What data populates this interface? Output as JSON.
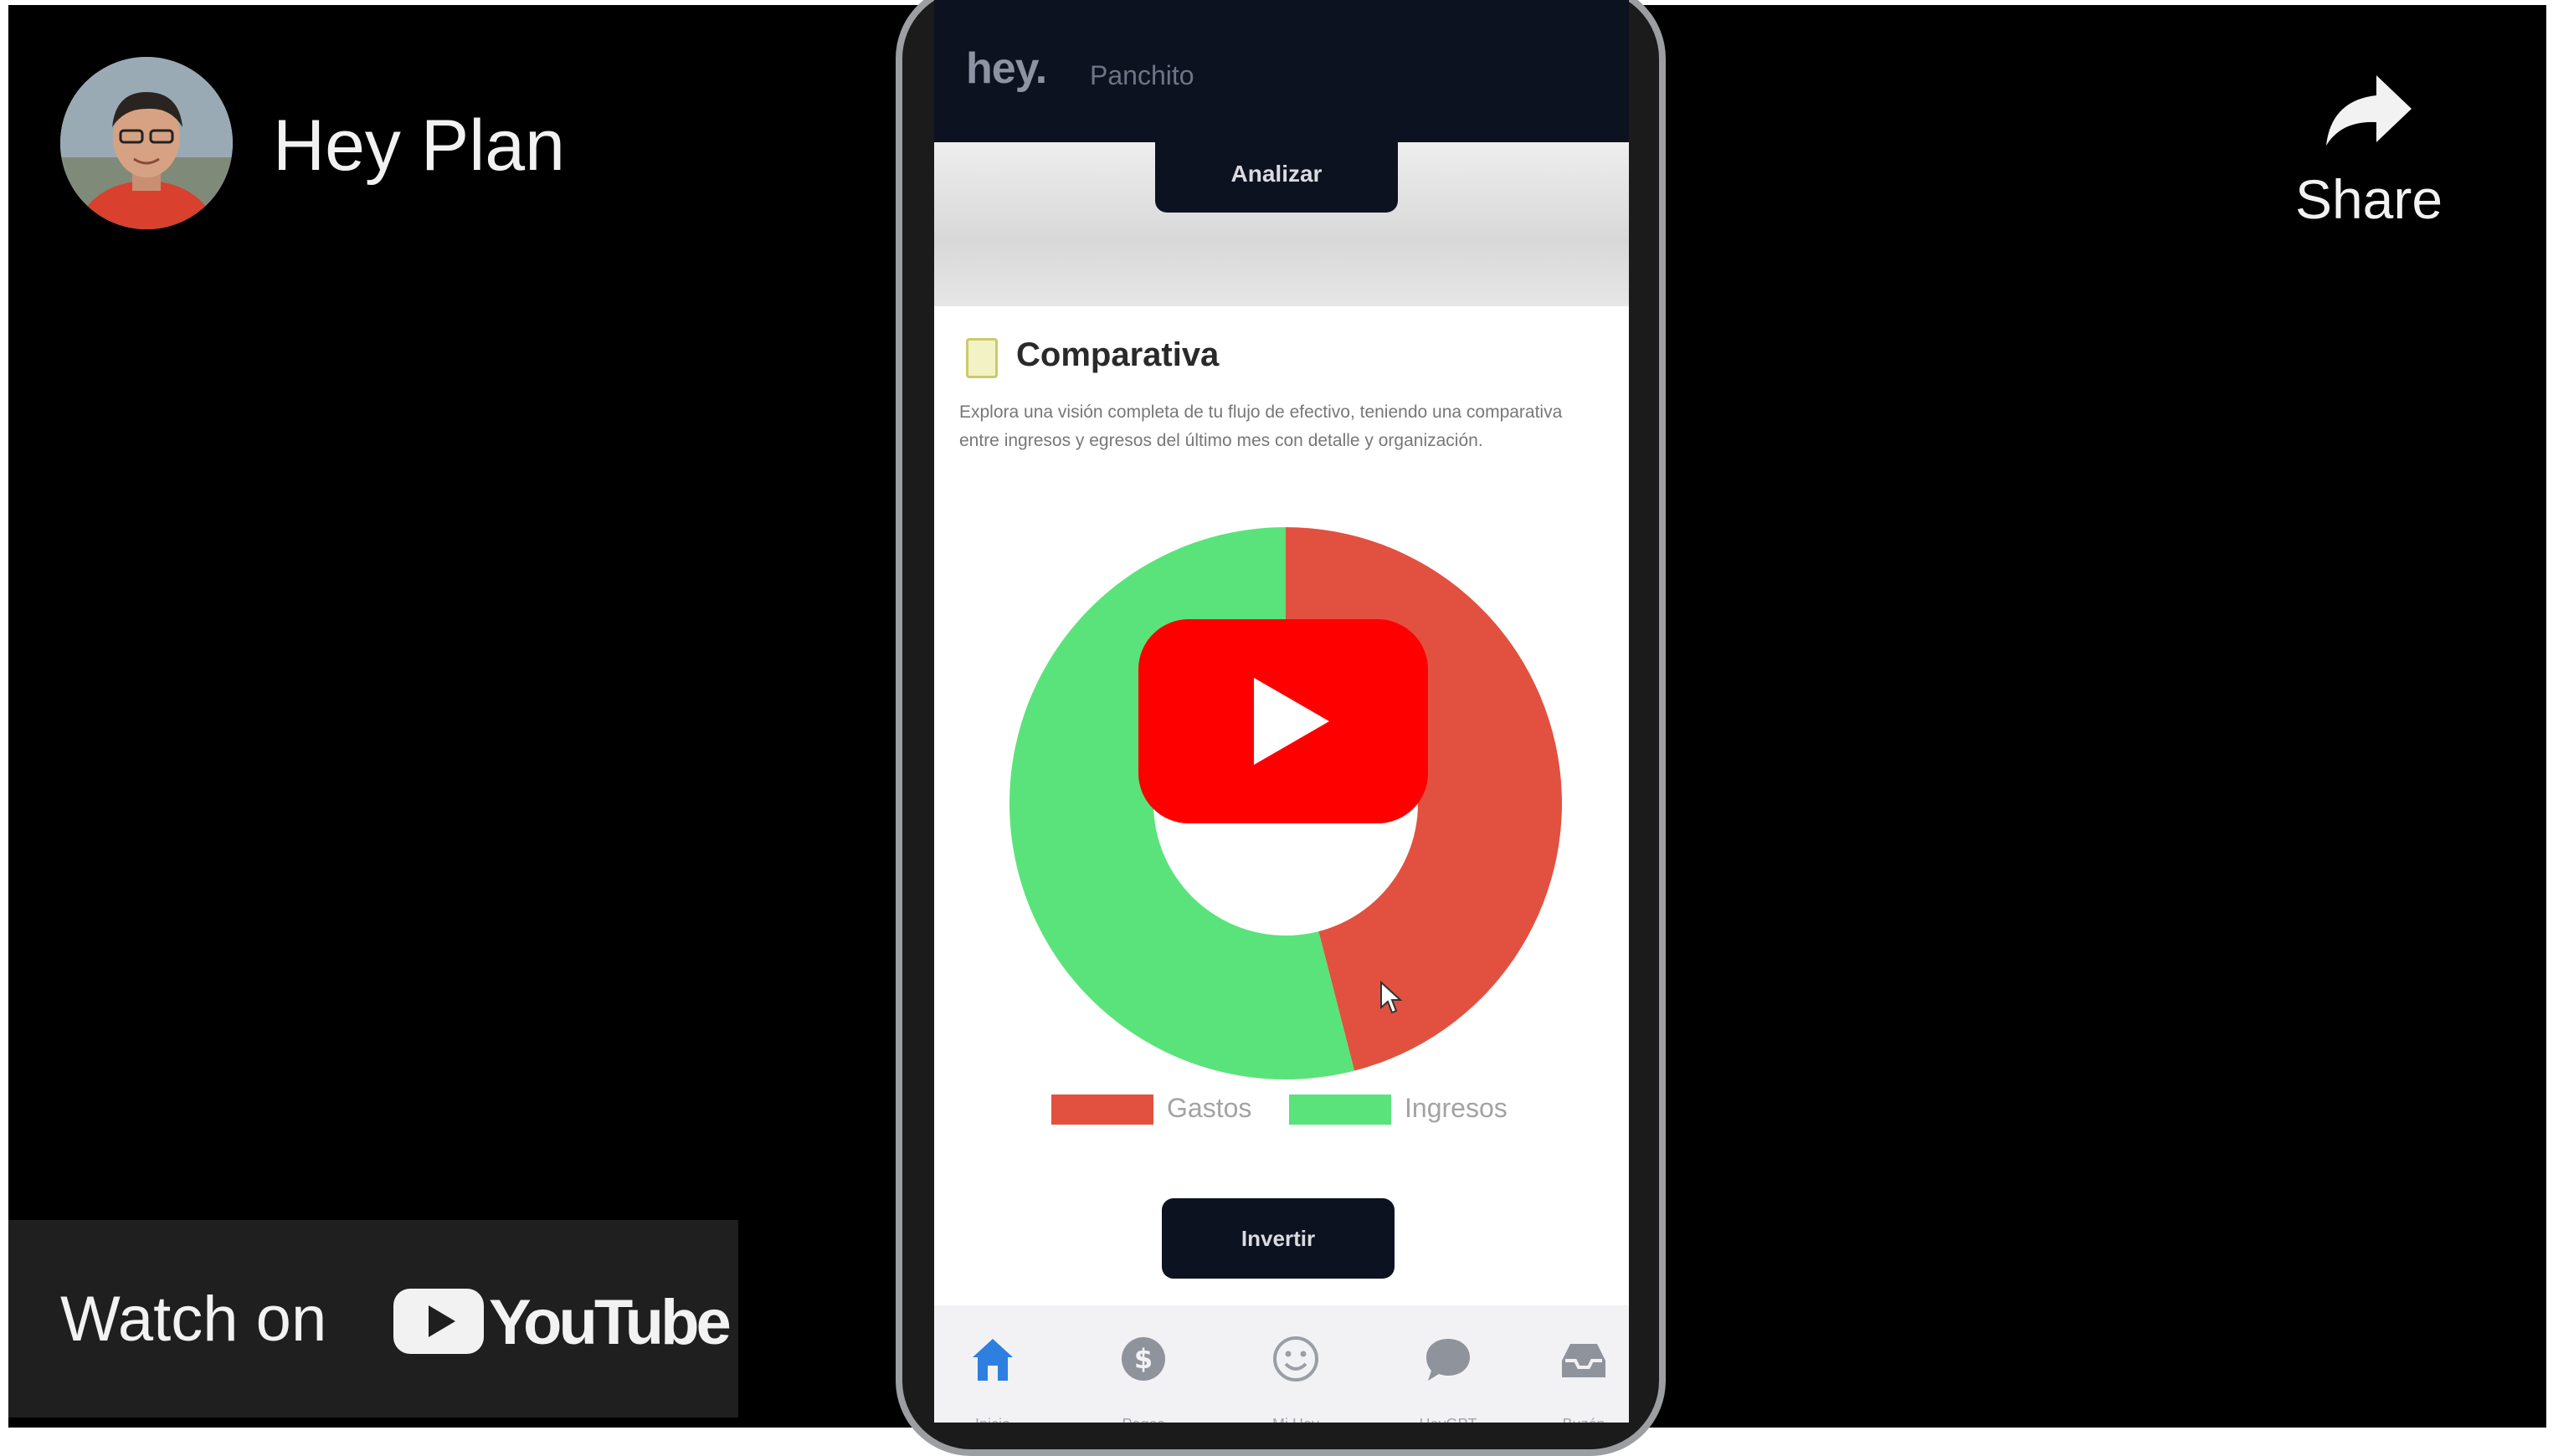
{
  "channel": {
    "name": "Hey Plan",
    "avatar_description": "avatar"
  },
  "share": {
    "label": "Share",
    "icon": "share-arrow-icon"
  },
  "watch_on": {
    "label": "Watch on",
    "platform": "YouTube"
  },
  "colors": {
    "player_bg": "#000000",
    "youtube_red": "#ff0000",
    "app_dark": "#0d1220",
    "gastos": "#e25140",
    "ingresos": "#5ae37a"
  },
  "app": {
    "logo": "hey.",
    "user": "Panchito",
    "analizar_label": "Analizar",
    "section": {
      "title": "Comparativa",
      "description": "Explora una visión completa de tu flujo de efectivo, teniendo una comparativa entre ingresos y egresos del último mes con detalle y organización."
    },
    "invertir_label": "Invertir",
    "nav": [
      {
        "label": "Inicio",
        "icon": "home-icon"
      },
      {
        "label": "Pagos",
        "icon": "dollar-coin-icon"
      },
      {
        "label": "Mi Hey",
        "icon": "smiley-icon"
      },
      {
        "label": "HeyGPT",
        "icon": "chat-bubble-icon"
      },
      {
        "label": "Buzón",
        "icon": "inbox-icon"
      }
    ]
  },
  "chart_data": {
    "type": "pie",
    "categories": [
      "Gastos",
      "Ingresos"
    ],
    "values": [
      46,
      54
    ],
    "legend": "bottom"
  }
}
